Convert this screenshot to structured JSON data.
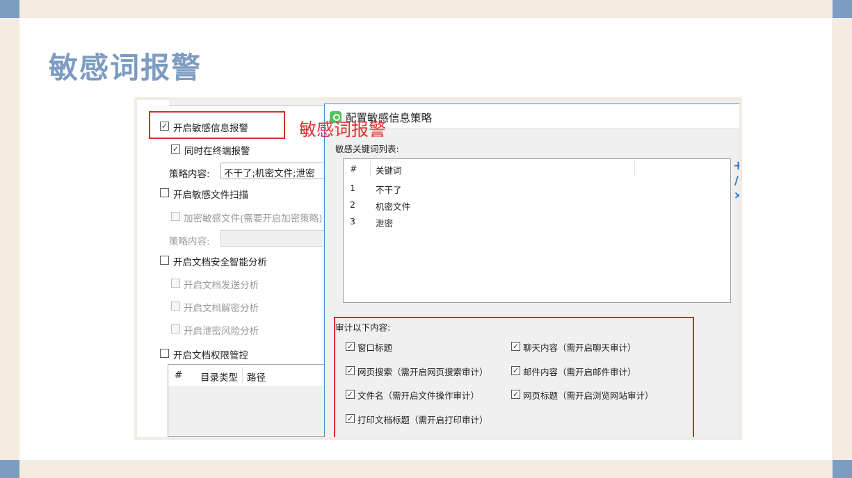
{
  "slide": {
    "title": "敏感词报警",
    "colors": {
      "accent": "#7d9cc2",
      "frame": "#f4ebe1",
      "annotation": "#e23232"
    }
  },
  "left_panel": {
    "enable_alert": "开启敏感信息报警",
    "terminal_alert": "同时在终端报警",
    "policy_label": "策略内容:",
    "policy_value": "不干了;机密文件;泄密",
    "file_scan": "开启敏感文件扫描",
    "encrypt_files": "加密敏感文件(需要开启加密策略)",
    "policy_label2": "策略内容:",
    "doc_ai": "开启文档安全智能分析",
    "doc_send": "开启文档发送分析",
    "doc_decrypt": "开启文档解密分析",
    "leak_risk": "开启泄密风险分析",
    "doc_perm": "开启文档权限管控",
    "table_headers": [
      "#",
      "目录类型",
      "路径"
    ]
  },
  "annotation": {
    "text": "敏感词报警"
  },
  "dialog": {
    "title": "配置敏感信息策略",
    "list_label": "敏感关键词列表:",
    "columns": {
      "num": "#",
      "keyword": "关键词"
    },
    "rows": [
      {
        "num": "1",
        "keyword": "不干了"
      },
      {
        "num": "2",
        "keyword": "机密文件"
      },
      {
        "num": "3",
        "keyword": "泄密"
      }
    ],
    "audit_label": "审计以下内容:",
    "audit_items": [
      "窗口标题",
      "聊天内容（需开启聊天审计）",
      "网页搜索（需开启网页搜索审计）",
      "邮件内容（需开启邮件审计）",
      "文件名（需开启文件操作审计）",
      "网页标题（需开启浏览网站审计）",
      "打印文档标题（需开启打印审计）"
    ],
    "side_icons": [
      "add-icon",
      "edit-icon",
      "delete-icon"
    ]
  }
}
